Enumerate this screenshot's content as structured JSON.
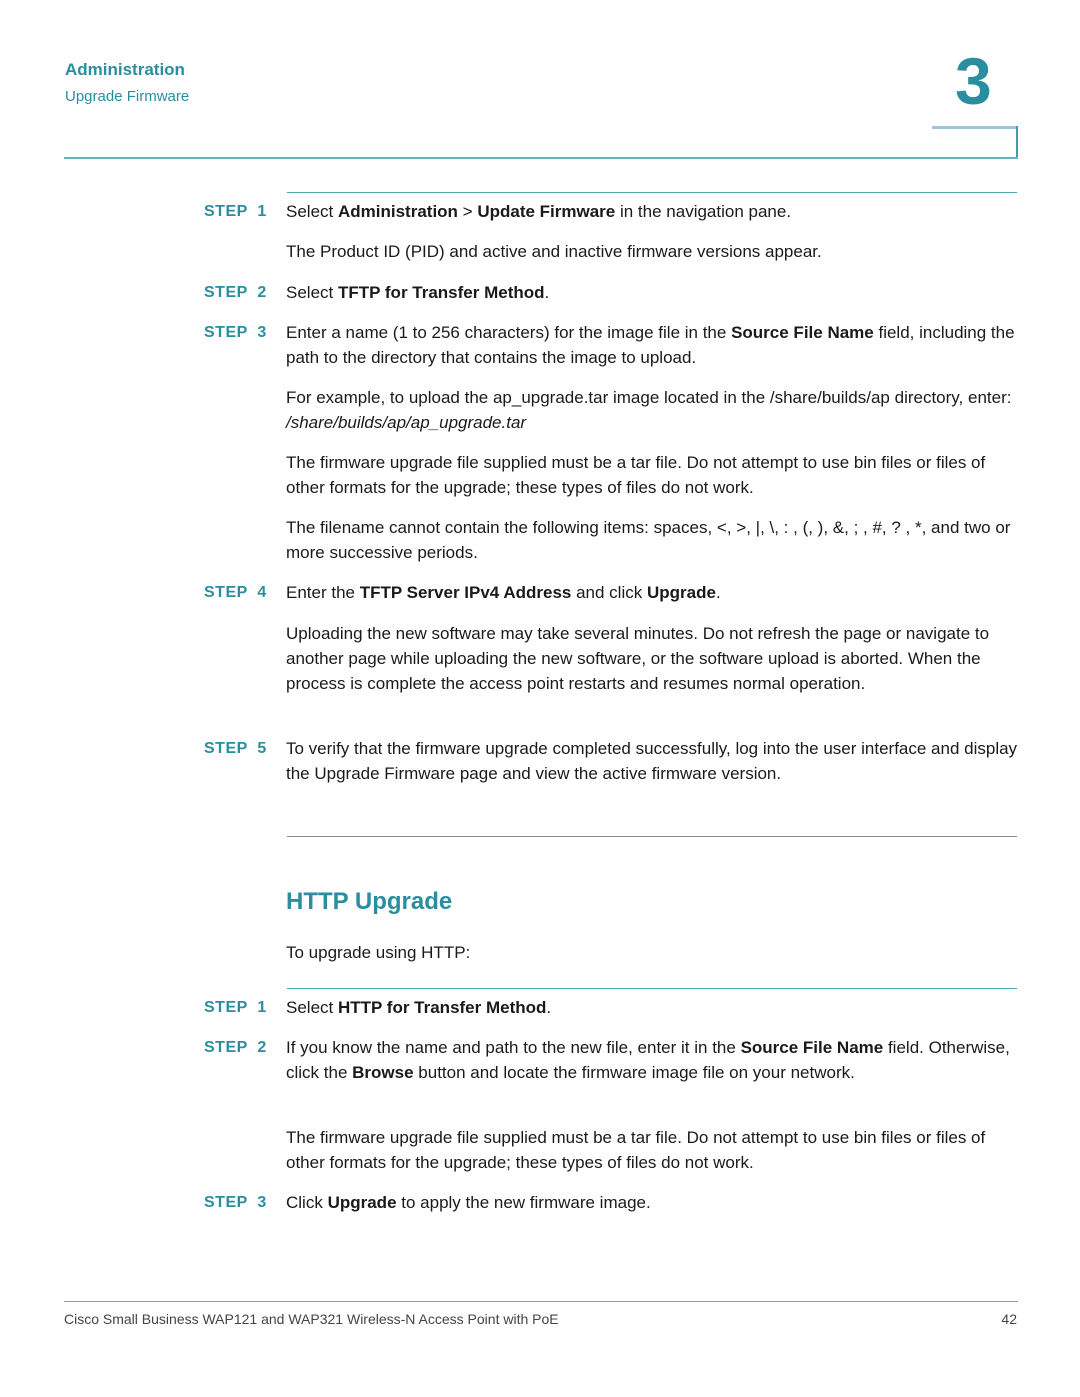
{
  "header": {
    "section": "Administration",
    "subsection": "Upgrade Firmware",
    "chapter_number": "3"
  },
  "tftp_steps": [
    {
      "label": "STEP  1",
      "parts": [
        [
          "Select ",
          ""
        ],
        [
          "Administration",
          "b"
        ],
        [
          " > ",
          ""
        ],
        [
          "Update Firmware",
          "b"
        ],
        [
          " in the navigation pane.",
          ""
        ]
      ],
      "notes": [
        "The Product ID (PID) and active and inactive firmware versions appear."
      ]
    },
    {
      "label": "STEP  2",
      "parts": [
        [
          "Select ",
          ""
        ],
        [
          "TFTP for Transfer Method",
          "b"
        ],
        [
          ".",
          ""
        ]
      ],
      "notes": []
    },
    {
      "label": "STEP  3",
      "parts": [
        [
          "Enter a name (1 to 256 characters) for the image file in the ",
          ""
        ],
        [
          "Source File Name",
          "b"
        ],
        [
          " field, including the path to the directory that contains the image to upload.",
          ""
        ]
      ],
      "notes": [
        "For example, to upload the ap_upgrade.tar image located in the /share/builds/ap directory, enter: ",
        "The firmware upgrade file supplied must be a tar file. Do not attempt to use bin files or files of other formats for the upgrade; these types of files do not work.",
        "The filename cannot contain the following items: spaces, <, >, |, \\, : , (, ), &, ; , #, ? , *, and two or more successive periods."
      ],
      "example_path": "/share/builds/ap/ap_upgrade.tar"
    },
    {
      "label": "STEP  4",
      "parts": [
        [
          "Enter the ",
          ""
        ],
        [
          "TFTP Server IPv4 Address",
          "b"
        ],
        [
          " and click ",
          ""
        ],
        [
          "Upgrade",
          "b"
        ],
        [
          ".",
          ""
        ]
      ],
      "notes": [
        "Uploading the new software may take several minutes. Do not refresh the page or navigate to another page while uploading the new software, or the software upload is aborted. When the process is complete the access point restarts and resumes normal operation."
      ]
    },
    {
      "label": "STEP  5",
      "parts": [
        [
          "To verify that the firmware upgrade completed successfully, log into the user interface and display the Upgrade Firmware page and view the active firmware version.",
          ""
        ]
      ],
      "notes": []
    }
  ],
  "http_section": {
    "title": "HTTP Upgrade",
    "intro": "To upgrade using HTTP:",
    "steps": [
      {
        "label": "STEP  1",
        "parts": [
          [
            "Select ",
            ""
          ],
          [
            "HTTP for Transfer Method",
            "b"
          ],
          [
            ".",
            ""
          ]
        ],
        "notes": []
      },
      {
        "label": "STEP  2",
        "parts": [
          [
            "If you know the name and path to the new file, enter it in the ",
            ""
          ],
          [
            "Source File Name",
            "b"
          ],
          [
            " field. Otherwise, click the ",
            ""
          ],
          [
            "Browse",
            "b"
          ],
          [
            " button and locate the firmware image file on your network.",
            ""
          ]
        ],
        "notes": [
          "The firmware upgrade file supplied must be a tar file. Do not attempt to use bin files or files of other formats for the upgrade; these types of files do not work."
        ]
      },
      {
        "label": "STEP  3",
        "parts": [
          [
            "Click ",
            ""
          ],
          [
            "Upgrade",
            "b"
          ],
          [
            " to apply the new firmware image.",
            ""
          ]
        ],
        "notes": []
      }
    ]
  },
  "footer": {
    "text": "Cisco Small Business WAP121 and WAP321 Wireless-N Access Point with PoE",
    "page_number": "42"
  }
}
